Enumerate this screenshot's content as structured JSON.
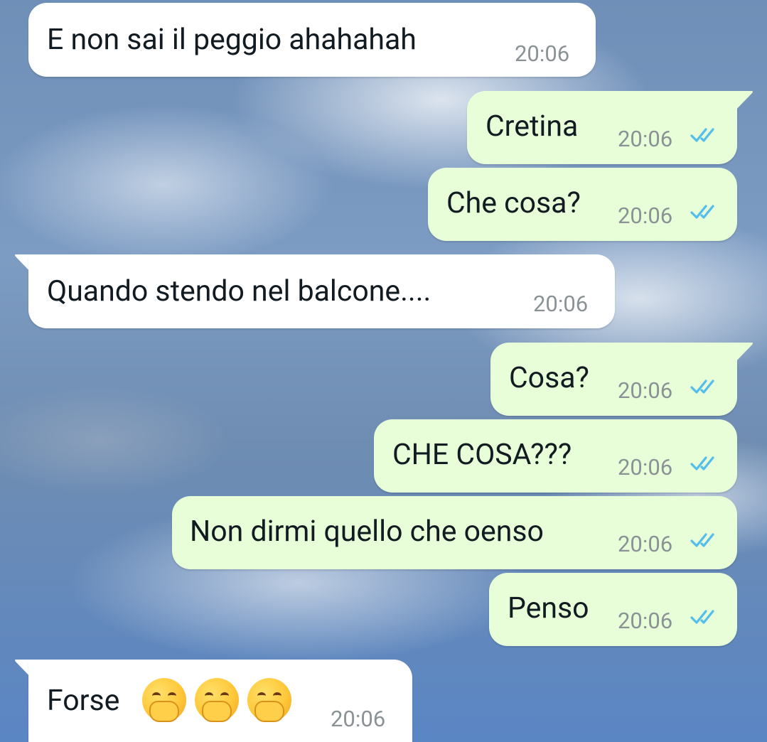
{
  "messages": [
    {
      "dir": "in",
      "text": "E non sai il peggio ahahahah",
      "time": "20:06"
    },
    {
      "dir": "out",
      "text": "Cretina",
      "time": "20:06",
      "status": "read-double-check"
    },
    {
      "dir": "out",
      "text": "Che cosa?",
      "time": "20:06",
      "status": "read-double-check"
    },
    {
      "dir": "in",
      "text": "Quando stendo nel balcone....",
      "time": "20:06"
    },
    {
      "dir": "out",
      "text": "Cosa?",
      "time": "20:06",
      "status": "read-double-check"
    },
    {
      "dir": "out",
      "text": "CHE COSA???",
      "time": "20:06",
      "status": "read-double-check"
    },
    {
      "dir": "out",
      "text": "Non dirmi quello che oenso",
      "time": "20:06",
      "status": "read-double-check"
    },
    {
      "dir": "out",
      "text": "Penso",
      "time": "20:06",
      "status": "read-double-check"
    },
    {
      "dir": "in",
      "text": "Forse",
      "time": "20:06",
      "emoji": "face-with-hand-over-mouth",
      "emoji_count": 3
    }
  ],
  "colors": {
    "incoming_bubble": "#ffffff",
    "outgoing_bubble": "#e7fed8",
    "read_ticks": "#53bdeb",
    "timestamp": "#8a9296"
  }
}
